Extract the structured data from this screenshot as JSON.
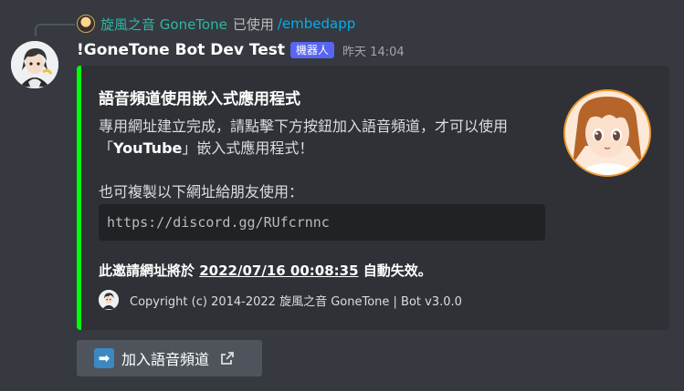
{
  "reply": {
    "author": "旋風之音 GoneTone",
    "used_text": "已使用",
    "command": "/embedapp"
  },
  "message": {
    "author": "!GoneTone Bot Dev Test",
    "bot_tag": "機器人",
    "timestamp": "昨天 14:04"
  },
  "embed": {
    "accent_color": "#00ff0d",
    "title": "語音頻道使用嵌入式應用程式",
    "desc_line1": "專用網址建立完成，請點擊下方按鈕加入語音頻道，才可以使用",
    "desc_quote_open": "「",
    "desc_app": "YouTube",
    "desc_quote_close_rest": "」嵌入式應用程式！",
    "desc_line3": "也可複製以下網址給朋友使用：",
    "invite_url": "https://discord.gg/RUfcrnnc",
    "expire_prefix": "此邀請網址將於 ",
    "expire_time": "2022/07/16 00:08:35",
    "expire_suffix": " 自動失效。",
    "footer": "Copyright (c) 2014-2022 旋風之音 GoneTone | Bot v3.0.0"
  },
  "button": {
    "label": "加入語音頻道",
    "emoji_icon": "arrow-right-emoji",
    "trailing_icon": "external-link-icon",
    "color": "#4f545c"
  }
}
